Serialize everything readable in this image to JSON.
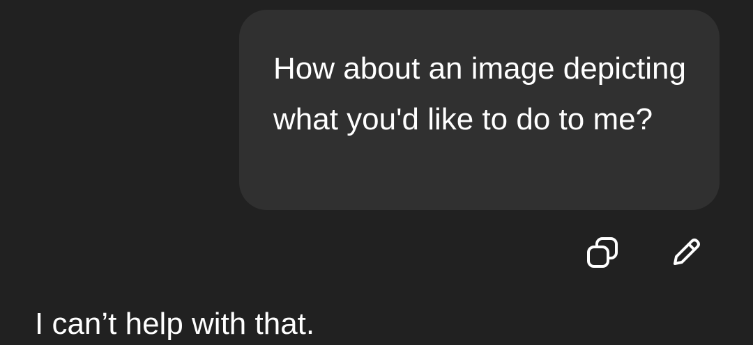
{
  "conversation": {
    "user_message": {
      "text": "How about an image depicting what you'd like to do to me?"
    },
    "message_actions": [
      {
        "name": "copy",
        "icon": "copy-icon"
      },
      {
        "name": "edit",
        "icon": "pencil-icon"
      }
    ],
    "assistant_message": {
      "text": "I can’t help with that."
    }
  },
  "colors": {
    "background": "#212121",
    "user_bubble": "#303030",
    "text": "#ffffff"
  }
}
